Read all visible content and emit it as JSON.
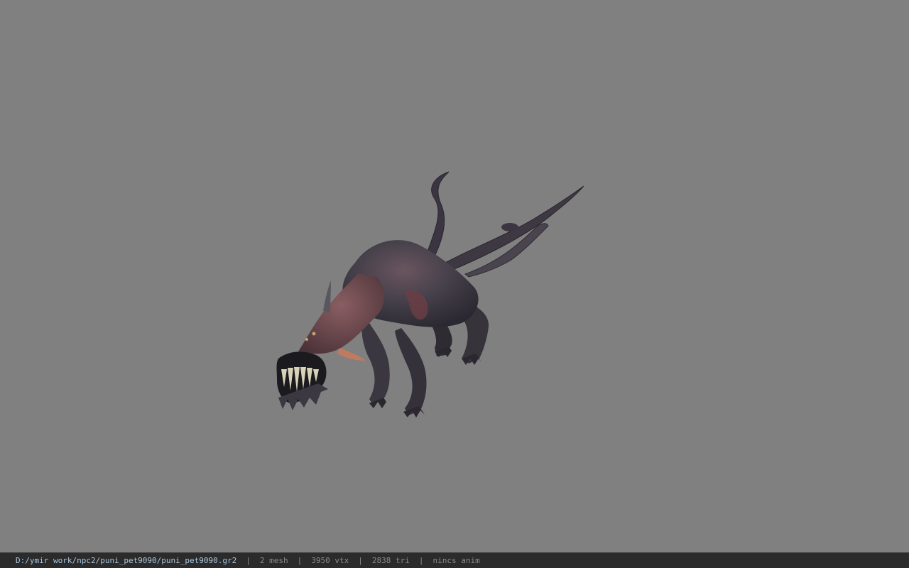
{
  "viewer": {
    "background_color": "#808080",
    "model_icon": "creature-model"
  },
  "statusbar": {
    "file_path": "D:/ymir work/npc2/puni_pet9090/puni_pet9090.gr2",
    "separator": "|",
    "mesh_count": "2 mesh",
    "vertex_count": "3950 vtx",
    "triangle_count": "2838 tri",
    "animation_status": "nincs anim"
  }
}
